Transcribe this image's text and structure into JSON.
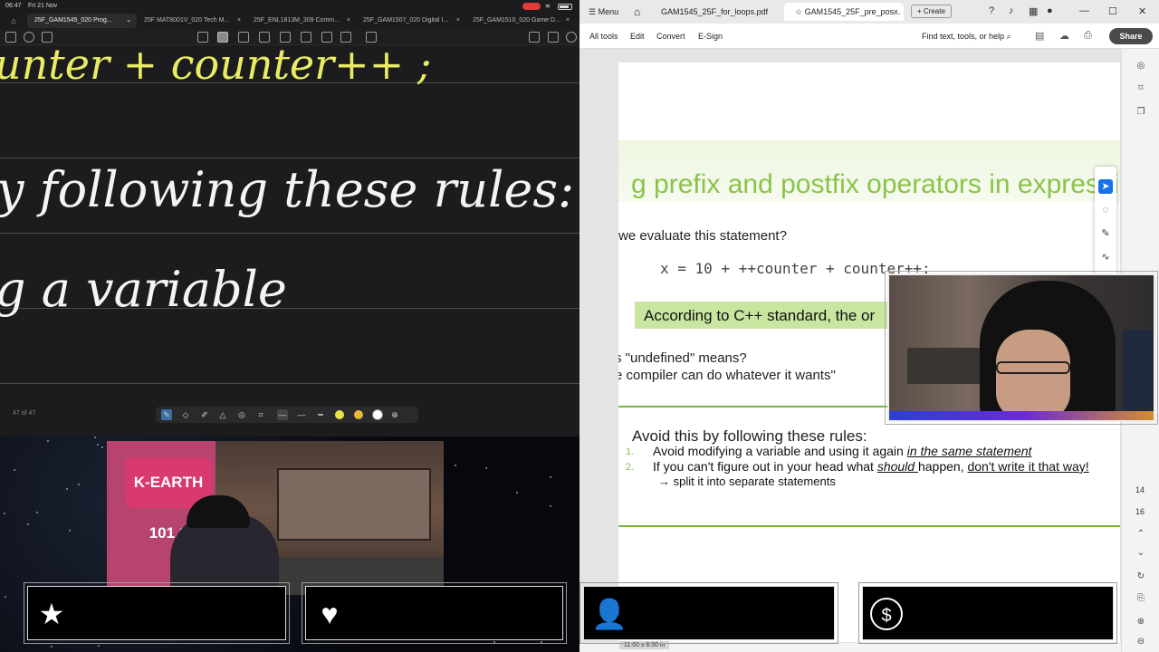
{
  "ipad": {
    "status": {
      "time": "06:47",
      "date": "Fri 21 Nov"
    },
    "tabs": [
      {
        "label": "25F_GAM1545_020 Prog...",
        "active": true
      },
      {
        "label": "25F MAT8001V_020 Tech M...",
        "active": false
      },
      {
        "label": "25F_ENL1813M_309 Comm...",
        "active": false
      },
      {
        "label": "25F_GAM1507_020 Digital I...",
        "active": false
      },
      {
        "label": "25F_GAM1510_020 Game D...",
        "active": false
      }
    ],
    "notes": {
      "line1": "unter + counter++ ;",
      "line2": "y following these rules:",
      "line3": "g a variable"
    },
    "page_count": "47 of 47",
    "pen_colors": [
      "#e6e64a",
      "#e8b93a",
      "#ffffff"
    ]
  },
  "radio_cam": {
    "logo": "K-EARTH 101.1"
  },
  "alerts": {
    "left": [
      {
        "icon": "star-icon"
      },
      {
        "icon": "heart-icon"
      }
    ],
    "right": [
      {
        "icon": "add-user-icon"
      },
      {
        "icon": "dollar-icon"
      }
    ]
  },
  "acrobat": {
    "menu_label": "Menu",
    "tabs": [
      {
        "label": "GAM1545_25F_for_loops.pdf",
        "active": false
      },
      {
        "label": "GAM1545_25F_pre_pos...",
        "active": true
      }
    ],
    "create_label": "+ Create",
    "toolbar": {
      "items": [
        "All tools",
        "Edit",
        "Convert",
        "E-Sign"
      ],
      "find_label": "Find text, tools, or help",
      "share_label": "Share"
    },
    "page": {
      "title": "g prefix and postfix operators in expressi",
      "question": "we evaluate this statement?",
      "code": "x = 10 + ++counter + counter++;",
      "highlight": "According to C++ standard, the or",
      "undefined_q": "s \"undefined\" means?",
      "undefined_a": "e compiler can do whatever it wants\"",
      "rules_heading": "Avoid this by following these rules:",
      "rule1_prefix": "Avoid modifying a variable and using it again ",
      "rule1_em": "in the same statement",
      "rule2_a": "If you can't figure out in your head what ",
      "rule2_em": "should ",
      "rule2_b": "happen, ",
      "rule2_u": "don't write it that way!",
      "rule2_sub": "→ split it into separate statements",
      "num1": "1.",
      "num2": "2."
    },
    "page_numbers": [
      "14",
      "16"
    ],
    "page_size": "11.00 x 8.50 in"
  }
}
